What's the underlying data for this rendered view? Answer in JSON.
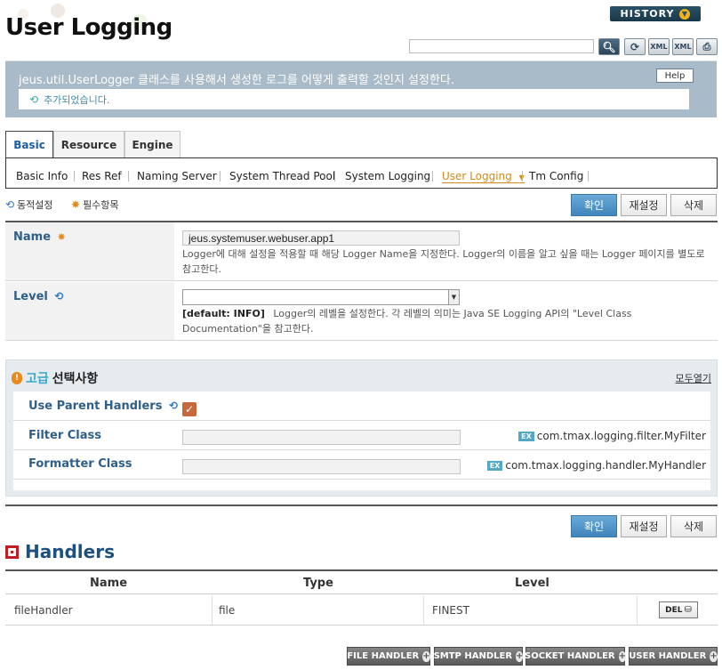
{
  "page": {
    "title": "User Logging"
  },
  "header": {
    "history_label": "HISTORY"
  },
  "toolbar": {
    "search_value": ""
  },
  "description": {
    "text": "jeus.util.UserLogger 클래스를 사용해서 생성한 로그를 어떻게 출력할 것인지 설정한다.",
    "help_label": "Help",
    "message": "추가되었습니다."
  },
  "tabs": [
    {
      "label": "Basic"
    },
    {
      "label": "Resource"
    },
    {
      "label": "Engine"
    }
  ],
  "subtabs": [
    {
      "label": "Basic Info"
    },
    {
      "label": "Res Ref"
    },
    {
      "label": "Naming Server"
    },
    {
      "label": "System Thread Pool"
    },
    {
      "label": "System Logging"
    },
    {
      "label": "User Logging"
    },
    {
      "label": "Tm Config"
    }
  ],
  "legend": {
    "dynamic": "동적설정",
    "required": "필수항목"
  },
  "actions": {
    "confirm": "확인",
    "reset": "재설정",
    "delete": "삭제"
  },
  "form": {
    "name": {
      "label": "Name",
      "value": "jeus.systemuser.webuser.app1",
      "help": "Logger에 대해 설정을 적용할 때 해당 Logger Name을 지정한다. Logger의 이름을 알고 싶을 때는 Logger 페이지를 별도로 참고한다."
    },
    "level": {
      "label": "Level",
      "value": "",
      "default": "[default: INFO]",
      "help": "Logger의 레벨을 설정한다. 각 레벨의 의미는 Java SE Logging API의 \"Level Class Documentation\"을 참고한다."
    }
  },
  "advanced": {
    "title_accent": "고급",
    "title_rest": "선택사항",
    "expand_all": "모두열기",
    "use_parent_handlers": {
      "label": "Use Parent Handlers",
      "checked": true
    },
    "filter_class": {
      "label": "Filter Class",
      "value": "",
      "example_badge": "EX",
      "example": "com.tmax.logging.filter.MyFilter"
    },
    "formatter_class": {
      "label": "Formatter Class",
      "value": "",
      "example_badge": "EX",
      "example": "com.tmax.logging.handler.MyHandler"
    }
  },
  "handlers": {
    "title": "Handlers",
    "columns": [
      "Name",
      "Type",
      "Level"
    ],
    "rows": [
      {
        "name": "fileHandler",
        "type": "file",
        "level": "FINEST",
        "action": "DEL"
      }
    ],
    "add_buttons": [
      "FILE HANDLER",
      "SMTP HANDLER",
      "SOCKET HANDLER",
      "USER HANDLER"
    ]
  },
  "colors": {
    "accent": "#3f85bb",
    "label": "#2f5e8a",
    "desc_bar": "#a9bac8",
    "active_subtab": "#d48a1a",
    "handlers_icon": "#c21d22"
  }
}
